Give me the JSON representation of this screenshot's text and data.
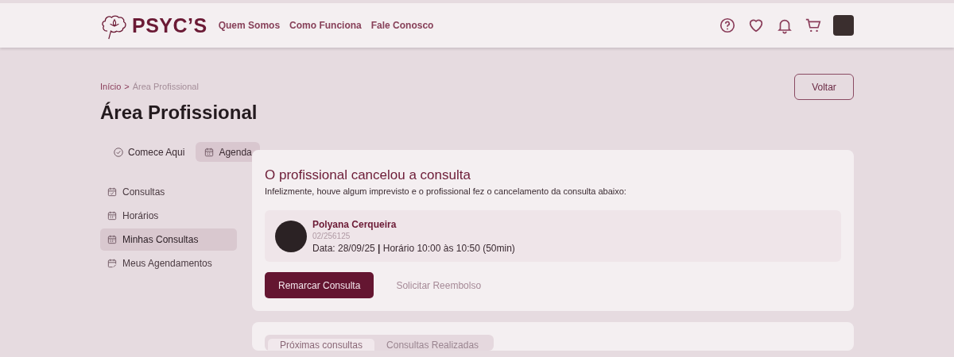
{
  "header": {
    "logo": "PSYC’S",
    "nav": [
      "Quem Somos",
      "Como Funciona",
      "Fale Conosco"
    ]
  },
  "breadcrumb": {
    "home": "Início",
    "separator": ">",
    "current": "Área Profissional"
  },
  "back_button": "Voltar",
  "page_title": "Área Profissional",
  "tabs": [
    {
      "label": "Comece Aqui",
      "kind": "check",
      "selected": false
    },
    {
      "label": "Agenda",
      "kind": "calendar",
      "selected": true
    }
  ],
  "sidebar": {
    "items": [
      {
        "label": "Consultas",
        "kind": "confirmed",
        "selected": false
      },
      {
        "label": "Horários",
        "kind": "calendar",
        "selected": false
      },
      {
        "label": "Minhas Consultas",
        "kind": "calendar",
        "selected": true
      },
      {
        "label": "Meus Agendamentos",
        "kind": "edit",
        "selected": false
      }
    ]
  },
  "cancel_card": {
    "title": "O profissional cancelou a consulta",
    "message": "Infelizmente, houve algum imprevisto e o profissional fez o cancelamento da consulta abaixo:",
    "appointment": {
      "name": "Polyana Cerqueira",
      "code": "02/256125",
      "details": "Data: 28/09/25 **|** Horário 10:00 às 10:50 (50min)"
    },
    "primary_button": "Remarcar Consulta",
    "secondary_button": "Solicitar Reembolso"
  },
  "consult_tabs": [
    {
      "label": "Próximas consultas",
      "selected": true
    },
    {
      "label": "Consultas Realizadas",
      "selected": false
    }
  ]
}
